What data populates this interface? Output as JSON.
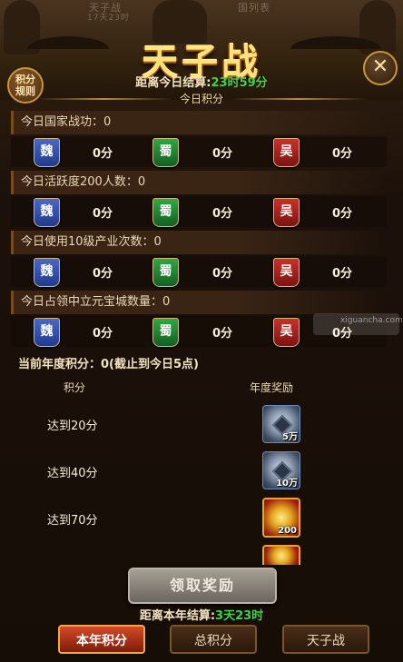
{
  "header": {
    "title": "天子战",
    "ghost_top_left": "天子战",
    "ghost_top_left_sub": "17天23时",
    "ghost_top_right": "国列表",
    "countdown_label": "距离今日结算:",
    "countdown_value": "23时59分",
    "rules_button": "积分\n规则",
    "close_icon": "✕"
  },
  "section_title": "今日积分",
  "metrics": [
    {
      "label": "今日国家战功：0",
      "scores": [
        "0分",
        "0分",
        "0分"
      ]
    },
    {
      "label": "今日活跃度200人数：0",
      "scores": [
        "0分",
        "0分",
        "0分"
      ]
    },
    {
      "label": "今日使用10级产业次数：0",
      "scores": [
        "0分",
        "0分",
        "0分"
      ]
    },
    {
      "label": "今日占领中立元宝城数量：0",
      "scores": [
        "0分",
        "0分",
        "0分"
      ]
    }
  ],
  "factions": [
    "魏",
    "蜀",
    "吴"
  ],
  "faction_colors": {
    "wei": "#2f4fae",
    "shu": "#1f8a32",
    "wu": "#a8241c"
  },
  "annual": {
    "summary": "当前年度积分：0(截止到今日5点)",
    "col_points": "积分",
    "col_reward": "年度奖励",
    "rows": [
      {
        "label": "达到20分",
        "reward_icon": "coin-icon",
        "qty": "5万"
      },
      {
        "label": "达到40分",
        "reward_icon": "coin-icon",
        "qty": "10万"
      },
      {
        "label": "达到70分",
        "reward_icon": "gold-ingot-icon",
        "qty": "200"
      }
    ]
  },
  "watermark": "xiguancha.com",
  "claim_button": "领取奖励",
  "year_end": {
    "label": "距离本年结算:",
    "value": "3天23时"
  },
  "tabs": [
    "本年积分",
    "总积分",
    "天子战"
  ],
  "active_tab": 0
}
